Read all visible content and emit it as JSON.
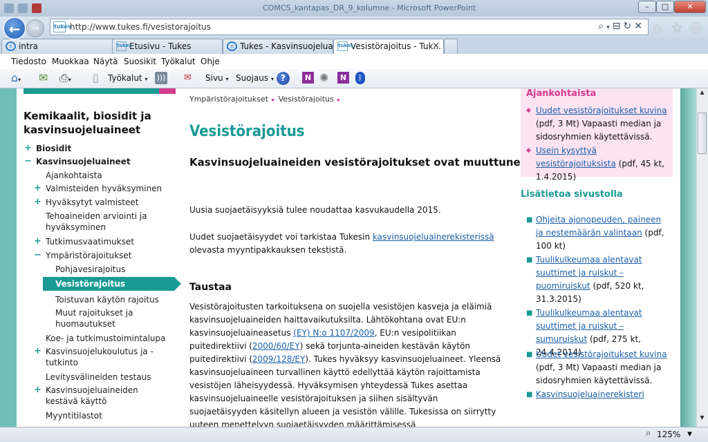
{
  "browser": {
    "window_title": "COMCS_kantapas_DR_9_kolumne - Microsoft PowerPoint",
    "address": {
      "url": "http://www.tukes.fi/vesistorajoitus",
      "favicon_text": "tukes"
    },
    "tabs": [
      {
        "label": "intra"
      },
      {
        "label": "Etusivu - Tukes"
      },
      {
        "label": "Tukes - Kasvinsuojeluai..."
      },
      {
        "label": "Vesistörajoitus - Tuk...",
        "close": "×"
      }
    ],
    "menu": [
      "Tiedosto",
      "Muokkaa",
      "Näytä",
      "Suosikit",
      "Työkalut",
      "Ohje"
    ],
    "command_bar": {
      "tyokalut": "Työkalut",
      "sivu": "Sivu",
      "suojaus": "Suojaus",
      "help": "?",
      "onenote": "N"
    },
    "status": {
      "zoom": "125%"
    }
  },
  "left_nav": {
    "heading": "Kemikaalit, biosidit ja kasvinsuojeluaineet",
    "items": [
      {
        "label": "Biosidit",
        "sign": "+"
      },
      {
        "label": "Kasvinsuojeluaineet",
        "sign": "−"
      },
      {
        "label": "Ajankohtaista"
      },
      {
        "label": "Valmisteiden hyväksyminen",
        "sign": "+"
      },
      {
        "label": "Hyväksytyt valmisteet",
        "sign": "+"
      },
      {
        "label": "Tehoaineiden arviointi ja hyväksyminen"
      },
      {
        "label": "Tutkimusvaatimukset",
        "sign": "+"
      },
      {
        "label": "Ympäristörajoitukset",
        "sign": "−"
      },
      {
        "label": "Pohjavesirajoitus"
      },
      {
        "label": "Vesistörajoitus"
      },
      {
        "label": "Toistuvan käytön rajoitus"
      },
      {
        "label": "Muut rajoitukset ja huomautukset"
      },
      {
        "label": "Koe- ja tutkimustoimintalupa"
      },
      {
        "label": "Kasvinsuojelukoulutus ja -tutkinto",
        "sign": "+"
      },
      {
        "label": "Levitysvälineiden testaus"
      },
      {
        "label": "Kasvinsuojeluaineiden kestävä käyttö",
        "sign": "+"
      },
      {
        "label": "Myyntitilastot"
      }
    ]
  },
  "main": {
    "breadcrumb": [
      "Ympäristörajoitukset",
      "Vesistörajoitus"
    ],
    "breadcrumb_sep": "▸",
    "title": "Vesistörajoitus",
    "lead": "Kasvinsuojeluaineiden vesistörajoitukset ovat muuttuneet",
    "p1": "Uusia suojaetäisyyksiä tulee noudattaa kasvukaudella 2015.",
    "p2": {
      "before": "Uudet suojaetäisyydet voi tarkistaa Tukesin ",
      "link": "kasvinsuojeluainerekisterissä",
      "after": " olevasta myyntipakkauksen tekstistä."
    },
    "section": "Taustaa",
    "p3": {
      "t1": "Vesistörajoitusten tarkoituksena on suojella vesistöjen kasveja ja eläimiä kasvinsuojeluaineiden haittavaikutuksilta. Lähtökohtana ovat EU:n kasvinsuojeluaineasetus ",
      "l1": "(EY) N:o 1107/2009",
      "t2": ", EU:n vesipolitiikan puitedirektiivi (",
      "l2": "2000/60/EY",
      "t3": ") sekä torjunta-aineiden kestävän käytön puitedirektiivi (",
      "l3": "2009/128/EY",
      "t4": "). Tukes hyväksyy kasvinsuojeluaineet. Yleensä kasvinsuojeluaineen turvallinen käyttö edellyttää käytön rajoittamista vesistöjen läheisyydessä. Hyväksymisen yhteydessä Tukes asettaa kasvinsuojeluaineelle vesistörajoituksen ja siihen sisältyvän suojaetäisyyden käsitellyn alueen ja vesistön välille. Tukesissa on siirrytty uuteen menettelyyn suojaetäisyyden määrittämisessä"
    }
  },
  "right": {
    "ajankohtaista": {
      "title": "Ajankohtaista",
      "items": [
        {
          "link": "Uudet vesistörajoitukset kuvina",
          "note": "(pdf, 3 Mt) Vapaasti median ja sidosryhmien käytettävissä."
        },
        {
          "link": "Usein kysyttyä vesistörajoituksista",
          "note": "(pdf, 45 kt, 1.4.2015)"
        }
      ]
    },
    "lisatietoa": {
      "title": "Lisätietoa sivustolla",
      "items": [
        {
          "link": "Ohjeita ajonopeuden, paineen ja nestemäärän valintaan",
          "note": "(pdf, 100 kt)"
        },
        {
          "link": "Tuulikulkeumaa alentavat suuttimet ja ruiskut – puomiruiskut",
          "note": "(pdf, 520 kt, 31.3.2015)"
        },
        {
          "link": "Tuulikulkeumaa alentavat suuttimet ja ruiskut – sumuruiskut",
          "note": "(pdf, 275 kt, 24.4.2014)"
        },
        {
          "link": "Uudet vesistörajoitukset kuvina",
          "note": "(pdf, 3 Mt) Vapaasti median ja sidosryhmien käytettävissä."
        },
        {
          "link": "Kasvinsuojeluainerekisteri",
          "note": ""
        }
      ]
    }
  }
}
